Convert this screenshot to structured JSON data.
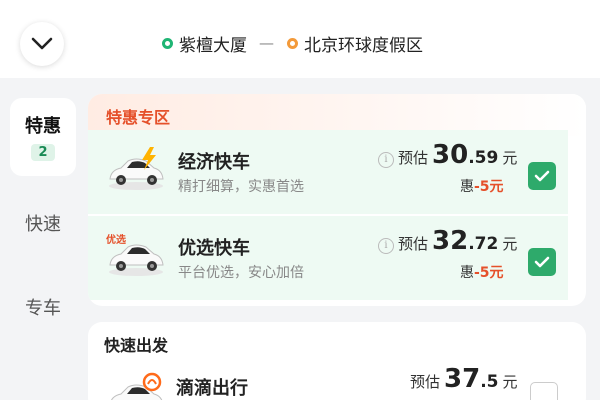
{
  "route": {
    "origin": "紫檀大厦",
    "separator": "—",
    "destination": "北京环球度假区"
  },
  "sidebar": {
    "items": [
      {
        "label": "特惠",
        "badge": "2",
        "active": true
      },
      {
        "label": "快速",
        "active": false
      },
      {
        "label": "专车",
        "active": false
      }
    ]
  },
  "promo_section": {
    "title": "特惠专区",
    "options": [
      {
        "name": "经济快车",
        "desc": "精打细算，实惠首选",
        "price_label": "预估",
        "price_int": "30",
        "price_dec": ".59",
        "unit": "元",
        "discount_label": "惠",
        "discount_value": "-5元",
        "selected": true,
        "icon": "car-lightning-icon"
      },
      {
        "name": "优选快车",
        "desc": "平台优选，安心加倍",
        "price_label": "预估",
        "price_int": "32",
        "price_dec": ".72",
        "unit": "元",
        "discount_label": "惠",
        "discount_value": "-5元",
        "selected": true,
        "car_tag": "优选",
        "icon": "car-premium-icon"
      }
    ]
  },
  "fast_section": {
    "title": "快速出发",
    "options": [
      {
        "name": "滴滴出行",
        "price_label": "预估",
        "price_int": "37",
        "price_dec": ".5",
        "unit": "元",
        "selected": false,
        "icon": "car-didi-icon"
      }
    ]
  },
  "colors": {
    "accent_green": "#2eaa6b",
    "promo_red": "#e5502a",
    "origin_dot": "#1fb574",
    "destination_dot": "#f39a3a"
  }
}
